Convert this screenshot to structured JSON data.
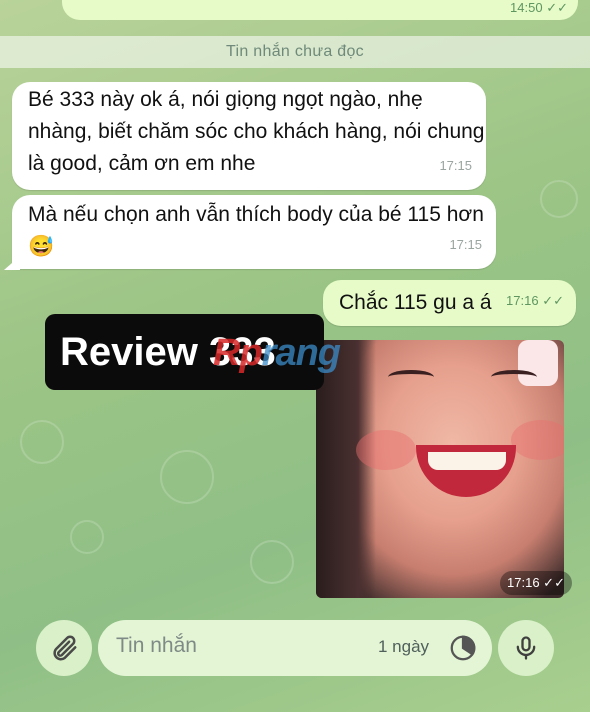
{
  "chat": {
    "top_message_time": "14:50",
    "unread_label": "Tin nhắn chưa đọc",
    "messages": [
      {
        "text": "Bé 333 này ok á, nói giọng ngọt ngào, nhẹ nhàng, biết chăm sóc cho khách hàng, nói chung là good, cảm ơn em nhe",
        "time": "17:15"
      },
      {
        "text": "Mà nếu chọn anh vẫn thích body của bé 115 hơn 😅",
        "time": "17:15"
      },
      {
        "text": "Chắc 115 gu a á",
        "time": "17:16"
      }
    ],
    "photo_time": "17:16",
    "overlay_badge": "Review 333",
    "watermark": {
      "part1": "R",
      "part2": "p",
      "part3": "rang"
    }
  },
  "composer": {
    "placeholder": "Tin nhắn",
    "timer_label": "1 ngày",
    "icons": {
      "attach": "paperclip-icon",
      "timer": "timer-icon",
      "mic": "microphone-icon"
    }
  },
  "colors": {
    "outgoing_bubble": "#e7fbc8",
    "incoming_bubble": "#ffffff",
    "check_color": "#5f9660"
  }
}
